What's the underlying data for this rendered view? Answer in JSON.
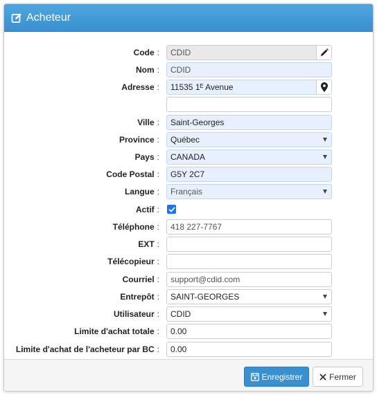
{
  "dialog": {
    "title": "Acheteur",
    "title_icon": "edit-icon"
  },
  "form": {
    "code": {
      "label": "Code",
      "value": "CDID",
      "button_icon": "pencil-icon"
    },
    "nom": {
      "label": "Nom",
      "value": "CDID"
    },
    "adresse": {
      "label": "Adresse",
      "value": "11535 1ᴱ Avenue",
      "button_icon": "map-marker-icon"
    },
    "adresse2": {
      "value": ""
    },
    "ville": {
      "label": "Ville",
      "value": "Saint-Georges"
    },
    "province": {
      "label": "Province",
      "value": "Québec"
    },
    "pays": {
      "label": "Pays",
      "value": "CANADA"
    },
    "code_postal": {
      "label": "Code Postal",
      "value": "G5Y 2C7"
    },
    "langue": {
      "label": "Langue",
      "value": "Français"
    },
    "actif": {
      "label": "Actif",
      "checked": true
    },
    "telephone": {
      "label": "Téléphone",
      "value": "418 227-7767"
    },
    "ext": {
      "label": "EXT",
      "value": ""
    },
    "telecopieur": {
      "label": "Télécopieur",
      "value": ""
    },
    "courriel": {
      "label": "Courriel",
      "value": "support@cdid.com"
    },
    "entrepot": {
      "label": "Entrepôt",
      "value": "SAINT-GEORGES"
    },
    "utilisateur": {
      "label": "Utilisateur",
      "value": "CDID"
    },
    "limite_totale": {
      "label": "Limite d'achat totale",
      "value": "0.00"
    },
    "limite_bc": {
      "label": "Limite d'achat de l'acheteur par BC",
      "value": "0.00"
    },
    "colon": ":"
  },
  "footer": {
    "save_label": "Enregistrer",
    "save_icon": "save-icon",
    "close_label": "Fermer",
    "close_icon": "close-icon"
  },
  "colors": {
    "header": "#3a8fcf",
    "autofill_field": "#e8f0fe",
    "disabled_field": "#e9e9e9",
    "primary_button": "#3a8fcf",
    "checkbox": "#1a73e8"
  }
}
